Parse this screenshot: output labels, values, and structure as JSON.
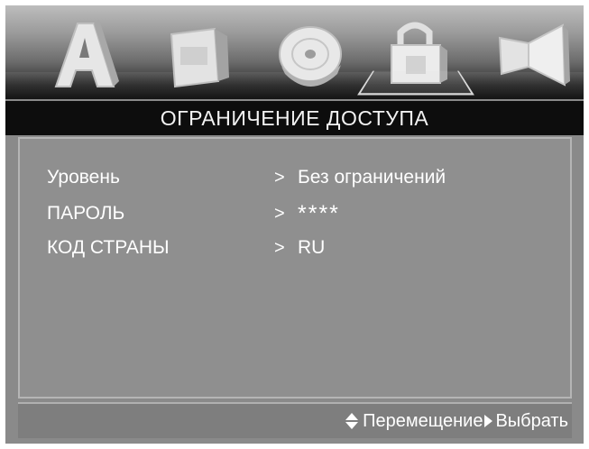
{
  "icon_bar": {
    "icons": [
      {
        "name": "audio-menu-icon",
        "selected": false
      },
      {
        "name": "video-menu-icon",
        "selected": false
      },
      {
        "name": "disc-menu-icon",
        "selected": false
      },
      {
        "name": "lock-menu-icon",
        "selected": true
      },
      {
        "name": "speaker-menu-icon",
        "selected": false
      }
    ]
  },
  "title": "ОГРАНИЧЕНИЕ ДОСТУПА",
  "settings": [
    {
      "label": "Уровень",
      "arrow": ">",
      "value": "Без ограничений"
    },
    {
      "label": "ПАРОЛЬ",
      "arrow": ">",
      "value": "****"
    },
    {
      "label": "КОД СТРАНЫ",
      "arrow": ">",
      "value": "RU"
    }
  ],
  "footer": {
    "move_label": "Перемещение",
    "select_label": "Выбрать"
  }
}
